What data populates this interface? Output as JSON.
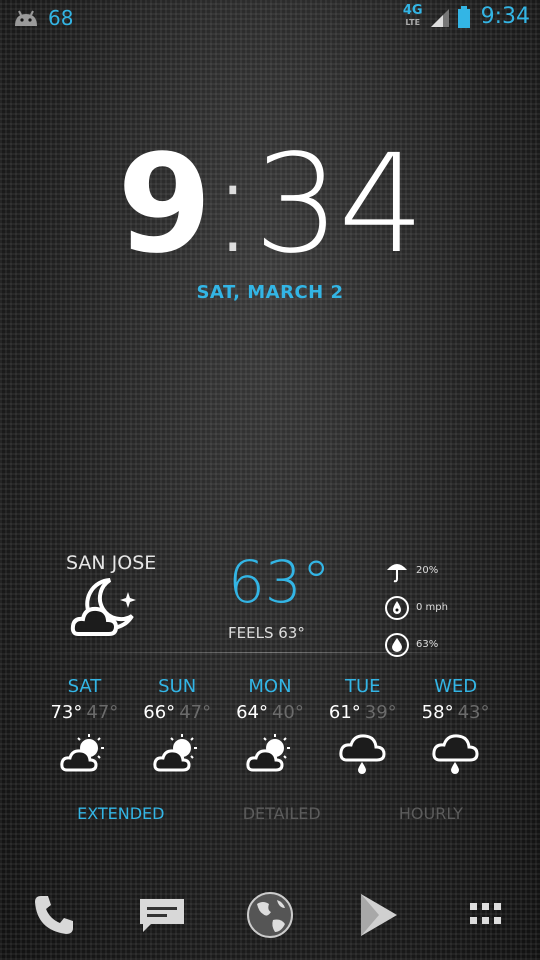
{
  "status_bar": {
    "notification_count": "68",
    "network_label": "4G",
    "network_sublabel": "LTE",
    "time": "9:34"
  },
  "clock": {
    "hour": "9",
    "colon": ":",
    "minute": "34"
  },
  "date": "SAT, MARCH 2",
  "weather": {
    "city": "SAN JOSE",
    "current_icon": "cloudy-night-icon",
    "temperature": "63°",
    "feels_like": "FEELS 63°",
    "precipitation": "20%",
    "wind": "0 mph",
    "humidity": "63%"
  },
  "forecast": [
    {
      "day": "SAT",
      "high": "73°",
      "low": "47°",
      "icon": "partly-sunny-icon"
    },
    {
      "day": "SUN",
      "high": "66°",
      "low": "47°",
      "icon": "partly-sunny-icon"
    },
    {
      "day": "MON",
      "high": "64°",
      "low": "40°",
      "icon": "partly-sunny-icon"
    },
    {
      "day": "TUE",
      "high": "61°",
      "low": "39°",
      "icon": "rain-icon"
    },
    {
      "day": "WED",
      "high": "58°",
      "low": "43°",
      "icon": "rain-icon"
    }
  ],
  "view_tabs": {
    "extended": "EXTENDED",
    "detailed": "DETAILED",
    "hourly": "HOURLY"
  },
  "dock": [
    "phone-icon",
    "messaging-icon",
    "browser-globe-icon",
    "play-store-icon",
    "app-drawer-icon"
  ],
  "colors": {
    "accent": "#33b5e5",
    "dim": "#6b6b6b"
  }
}
